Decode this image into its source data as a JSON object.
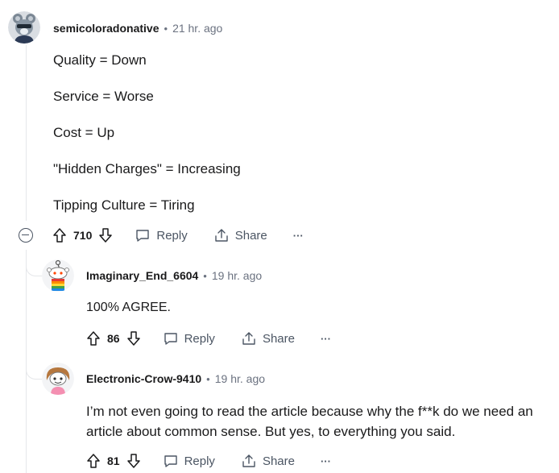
{
  "comments": [
    {
      "author": "semicoloradonative",
      "time": "21 hr. ago",
      "lines": [
        "Quality = Down",
        "Service = Worse",
        "Cost = Up",
        "\"Hidden Charges\" = Increasing",
        "Tipping Culture = Tiring"
      ],
      "score": "710",
      "reply_label": "Reply",
      "share_label": "Share",
      "more_label": "···"
    },
    {
      "author": "Imaginary_End_6604",
      "time": "19 hr. ago",
      "text": "100% AGREE.",
      "score": "86",
      "reply_label": "Reply",
      "share_label": "Share",
      "more_label": "···"
    },
    {
      "author": "Electronic-Crow-9410",
      "time": "19 hr. ago",
      "text": "I’m not even going to read the article because why the f**k do we need an article about common sense. But yes, to everything you said.",
      "score": "81",
      "reply_label": "Reply",
      "share_label": "Share",
      "more_label": "···"
    }
  ],
  "separator": "•"
}
